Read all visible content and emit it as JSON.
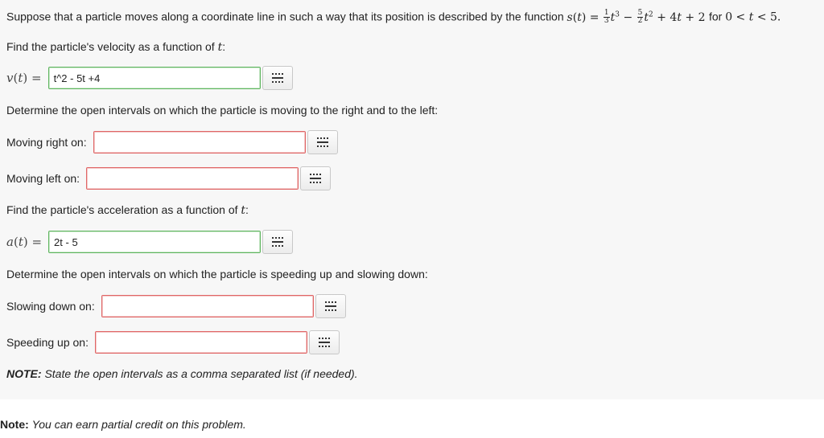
{
  "problem": {
    "intro_prefix": "Suppose that a particle moves along a coordinate line in such a way that its position is described by the function",
    "intro_for": "for",
    "velocity_prompt": "Find the particle's velocity as a function of",
    "velocity_var": "t",
    "velocity_label_fn": "v",
    "velocity_value": "t^2 - 5t +4",
    "direction_prompt": "Determine the open intervals on which the particle is moving to the right and to the left:",
    "moving_right_label": "Moving right on:",
    "moving_right_value": "",
    "moving_left_label": "Moving left on:",
    "moving_left_value": "",
    "accel_prompt": "Find the particle's acceleration as a function of",
    "accel_label_fn": "a",
    "accel_value": "2t - 5",
    "speed_prompt": "Determine the open intervals on which the particle is speeding up and slowing down:",
    "slowing_label": "Slowing down on:",
    "slowing_value": "",
    "speeding_label": "Speeding up on:",
    "speeding_value": "",
    "note_label": "NOTE:",
    "note_text": "State the open intervals as a comma separated list (if needed)."
  },
  "footer": {
    "label": "Note:",
    "text": "You can earn partial credit on this problem."
  },
  "icons": {
    "equation_editor": "grid-icon"
  },
  "colors": {
    "correct_border": "#5fb55f",
    "incorrect_border": "#e06666"
  }
}
